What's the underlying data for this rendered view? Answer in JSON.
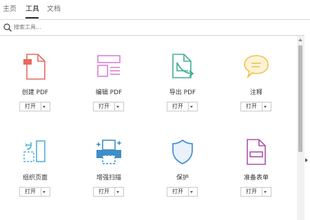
{
  "tabs": [
    {
      "label": "主页",
      "active": false
    },
    {
      "label": "工具",
      "active": true
    },
    {
      "label": "文档",
      "active": false
    }
  ],
  "search": {
    "placeholder": "搜索工具...",
    "icon": "search-icon"
  },
  "tools": [
    {
      "label": "创建 PDF",
      "open_label": "打开",
      "icon": "create-pdf-icon",
      "color": "#e8695f"
    },
    {
      "label": "编辑 PDF",
      "open_label": "打开",
      "icon": "edit-pdf-icon",
      "color": "#d97ed8"
    },
    {
      "label": "导出 PDF",
      "open_label": "打开",
      "icon": "export-pdf-icon",
      "color": "#3fae8f"
    },
    {
      "label": "注释",
      "open_label": "打开",
      "icon": "comment-icon",
      "color": "#f2c14e"
    },
    {
      "label": "组织页面",
      "open_label": "打开",
      "icon": "organize-pages-icon",
      "color": "#4fb0d9"
    },
    {
      "label": "增强扫描",
      "open_label": "打开",
      "icon": "enhance-scan-icon",
      "color": "#3e8fc7"
    },
    {
      "label": "保护",
      "open_label": "打开",
      "icon": "protect-icon",
      "color": "#4a90d9"
    },
    {
      "label": "准备表单",
      "open_label": "打开",
      "icon": "prepare-form-icon",
      "color": "#b04fa8"
    }
  ]
}
